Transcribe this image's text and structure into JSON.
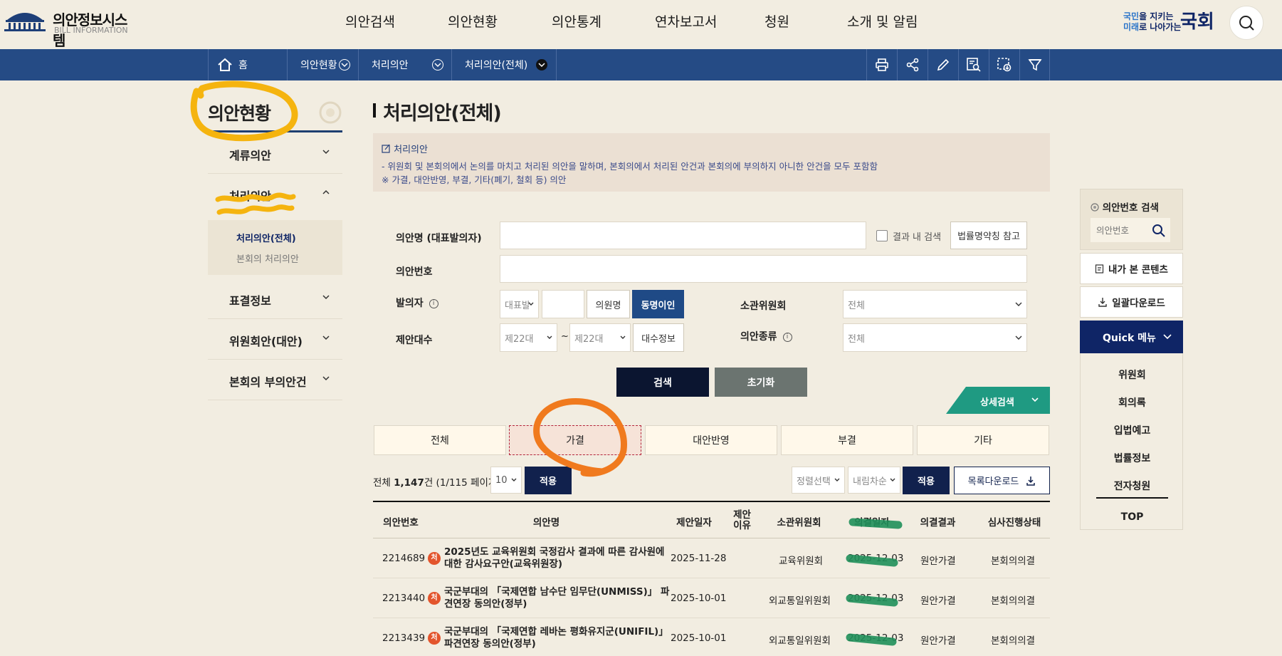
{
  "header": {
    "logo_title": "의안정보시스템",
    "logo_sub": "BILL INFORMATION",
    "gnb": [
      "의안검색",
      "의안현황",
      "의안통계",
      "연차보고서",
      "청원",
      "소개 및 알림"
    ],
    "slogan_line1_a": "국민",
    "slogan_line1_b": "을 지키는",
    "slogan_line2_a": "미래",
    "slogan_line2_b": "로 나아가는",
    "slogan_brand": "국회"
  },
  "navbar": {
    "home": "홈",
    "crumbs": [
      "의안현황",
      "처리의안",
      "처리의안(전체)"
    ]
  },
  "lnb": {
    "title": "의안현황",
    "items": [
      "계류의안",
      "처리의안",
      "표결정보",
      "위원회안(대안)",
      "본회의 부의안건"
    ],
    "sub": [
      "처리의안(전체)",
      "본회의 처리의안"
    ]
  },
  "page": {
    "title": "처리의안(전체)",
    "info_head": "처리의안",
    "info_line1": "- 위원회 및 본회의에서 논의를 마치고 처리된 의안을 말하며, 본회의에서 처리된 안건과 본회의에 부의하지 아니한 안건을 모두 포함함",
    "info_line2": "※ 가결, 대안반영, 부결, 기타(폐기, 철회 등) 의안"
  },
  "form": {
    "bill_name_label": "의안명 (대표발의자)",
    "in_result_label": "결과 내 검색",
    "law_abbr_btn": "법률명약칭 참고",
    "bill_no_label": "의안번호",
    "proposer_label": "발의자",
    "proposer_type": "대표발",
    "member_btn": "의원명",
    "homonym_btn": "동명이인",
    "committee_label": "소관위원회",
    "committee_value": "전체",
    "term_label": "제안대수",
    "term_from": "제22대",
    "term_sep": "~",
    "term_to": "제22대",
    "term_btn": "대수정보",
    "kind_label": "의안종류",
    "kind_value": "전체",
    "search_btn": "검색",
    "reset_btn": "초기화",
    "detail_btn": "상세검색"
  },
  "tabs": [
    "전체",
    "가결",
    "대안반영",
    "부결",
    "기타"
  ],
  "list": {
    "total_prefix": "전체 ",
    "total_count": "1,147",
    "total_suffix": "건 (1/115 페이지)",
    "page_size": "10",
    "apply": "적용",
    "sort_select": "정렬선택",
    "order_select": "내림차순",
    "download": "목록다운로드"
  },
  "table": {
    "headers": [
      "의안번호",
      "의안명",
      "제안일자",
      "제안\n이유",
      "소관위원회",
      "의결일자",
      "의결결과",
      "심사진행상태"
    ],
    "rows": [
      {
        "no": "2214689",
        "badge": "처",
        "name": "2025년도 교육위원회 국정감사 결과에 따른 감사원에 대한 감사요구안(교육위원장)",
        "date": "2025-11-28",
        "committee": "교육위원회",
        "decided": "2025-12-03",
        "result": "원안가결",
        "status": "본회의의결"
      },
      {
        "no": "2213440",
        "badge": "처",
        "name": "국군부대의 「국제연합 남수단 임무단(UNMISS)」 파견연장 동의안(정부)",
        "date": "2025-10-01",
        "committee": "외교통일위원회",
        "decided": "2025-12-03",
        "result": "원안가결",
        "status": "본회의의결"
      },
      {
        "no": "2213439",
        "badge": "처",
        "name": "국군부대의 「국제연합 레바논 평화유지군(UNIFIL)」 파견연장 동의안(정부)",
        "date": "2025-10-01",
        "committee": "외교통일위원회",
        "decided": "2025-12-03",
        "result": "원안가결",
        "status": "본회의의결"
      }
    ]
  },
  "quick": {
    "search_title": "의안번호 검색",
    "search_placeholder": "의안번호",
    "my_content": "내가 본 콘텐츠",
    "bulk_download": "일괄다운로드",
    "menu_title": "Quick 메뉴",
    "links": [
      "위원회",
      "회의록",
      "입법예고",
      "법률정보",
      "전자청원"
    ],
    "top": "TOP"
  },
  "colors": {
    "navy": "#0f2566",
    "nav_bar": "#254b85",
    "teal": "#1f9a82",
    "annot_orange": "#f07a1e",
    "annot_yellow": "#f5b40f",
    "annot_green": "#1f8f5a"
  }
}
